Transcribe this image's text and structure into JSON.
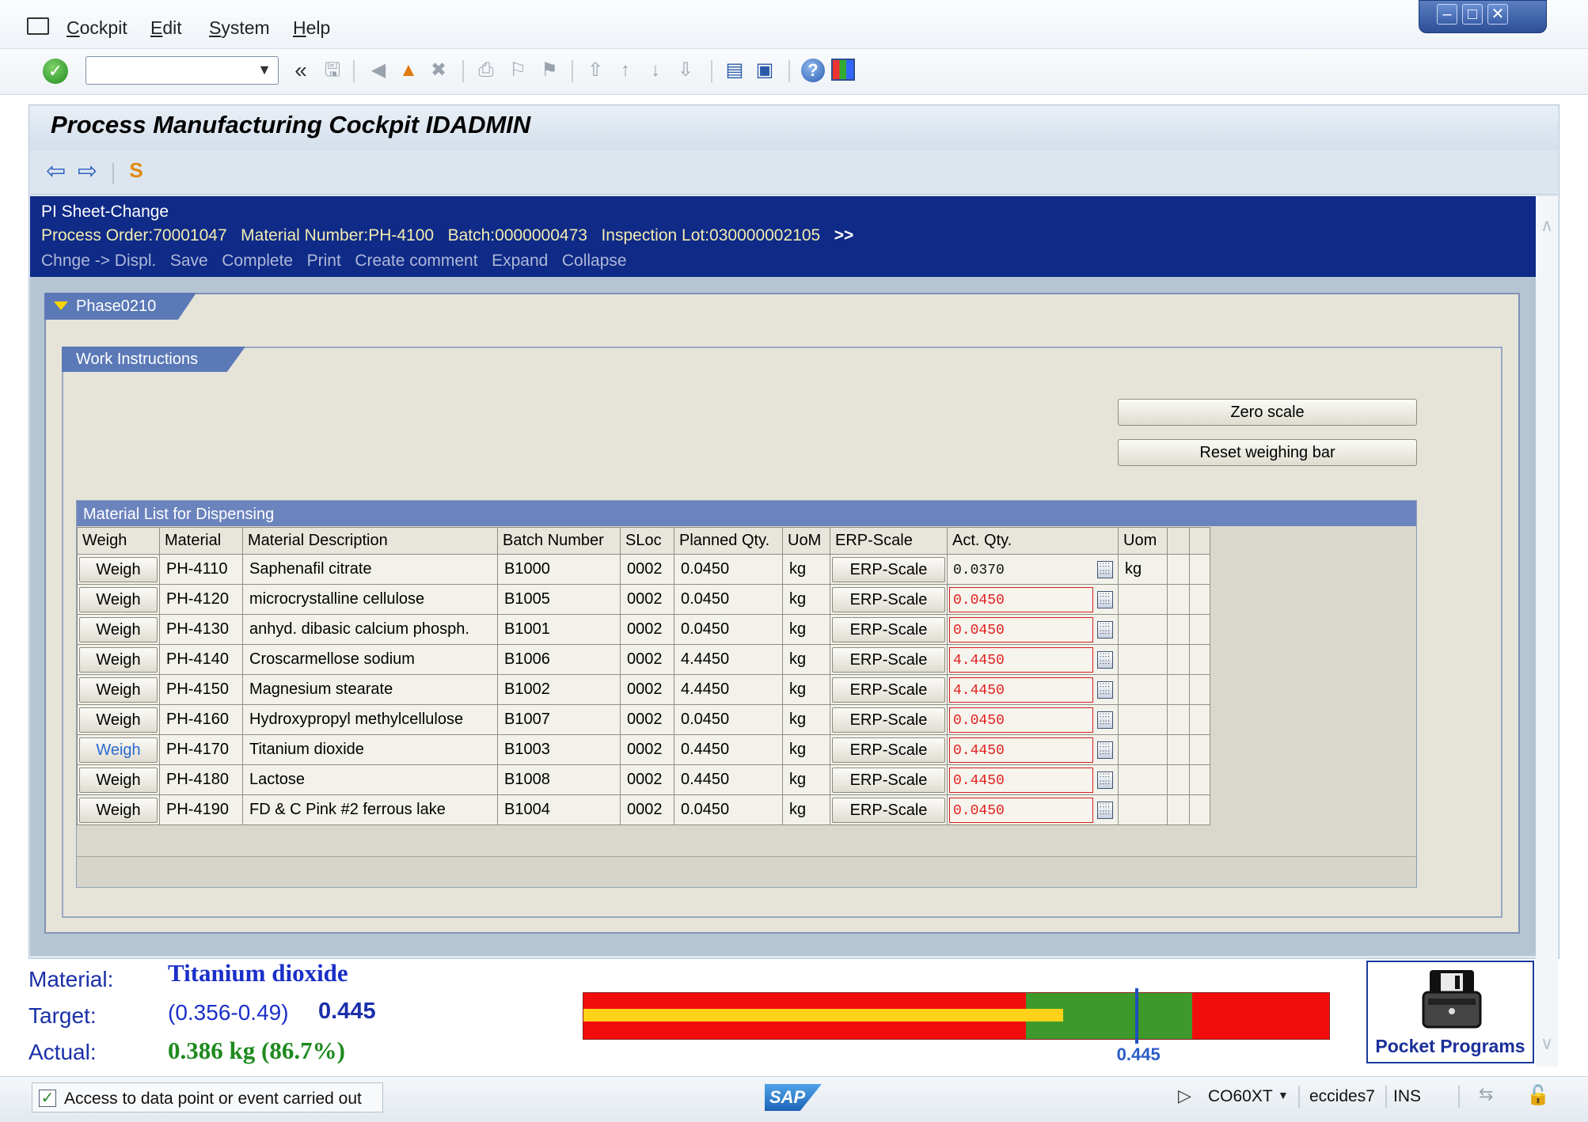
{
  "menu": {
    "items": [
      {
        "u": "C",
        "rest": "ockpit"
      },
      {
        "u": "E",
        "rest": "dit"
      },
      {
        "u": "S",
        "rest": "ystem"
      },
      {
        "u": "H",
        "rest": "elp"
      }
    ]
  },
  "toolbar": {
    "command_value": "",
    "back_glyph": "«"
  },
  "page": {
    "title": "Process Manufacturing Cockpit IDADMIN"
  },
  "pi_header": {
    "title": "PI Sheet-Change",
    "process_order": "Process Order:70001047",
    "material_number": "Material Number:PH-4100",
    "batch": "Batch:0000000473",
    "inspection_lot": "Inspection Lot:030000002105",
    "more": ">>",
    "actions": [
      "Chnge -> Displ.",
      "Save",
      "Complete",
      "Print",
      "Create comment",
      "Expand",
      "Collapse"
    ]
  },
  "phase": {
    "label": "Phase0210",
    "work_instructions": "Work Instructions",
    "zero_scale": "Zero scale",
    "reset_bar": "Reset weighing bar"
  },
  "material_list": {
    "title": "Material List for Dispensing",
    "columns": [
      "Weigh",
      "Material",
      "Material Description",
      "Batch Number",
      "SLoc",
      "Planned Qty.",
      "UoM",
      "ERP-Scale",
      "Act. Qty.",
      "Uom",
      "",
      ""
    ],
    "rows": [
      {
        "weigh": "Weigh",
        "material": "PH-4110",
        "desc": "Saphenafil citrate",
        "batch": "B1000",
        "sloc": "0002",
        "planned": "0.0450",
        "uom": "kg",
        "scale": "ERP-Scale",
        "act": "0.0370",
        "uom2": "kg"
      },
      {
        "weigh": "Weigh",
        "material": "PH-4120",
        "desc": "microcrystalline cellulose",
        "batch": "B1005",
        "sloc": "0002",
        "planned": "0.0450",
        "uom": "kg",
        "scale": "ERP-Scale",
        "act": "0.0450",
        "uom2": ""
      },
      {
        "weigh": "Weigh",
        "material": "PH-4130",
        "desc": "anhyd. dibasic calcium phosph.",
        "batch": "B1001",
        "sloc": "0002",
        "planned": "0.0450",
        "uom": "kg",
        "scale": "ERP-Scale",
        "act": "0.0450",
        "uom2": ""
      },
      {
        "weigh": "Weigh",
        "material": "PH-4140",
        "desc": "Croscarmellose sodium",
        "batch": "B1006",
        "sloc": "0002",
        "planned": "4.4450",
        "uom": "kg",
        "scale": "ERP-Scale",
        "act": "4.4450",
        "uom2": ""
      },
      {
        "weigh": "Weigh",
        "material": "PH-4150",
        "desc": "Magnesium stearate",
        "batch": "B1002",
        "sloc": "0002",
        "planned": "4.4450",
        "uom": "kg",
        "scale": "ERP-Scale",
        "act": "4.4450",
        "uom2": ""
      },
      {
        "weigh": "Weigh",
        "material": "PH-4160",
        "desc": "Hydroxypropyl methylcellulose",
        "batch": "B1007",
        "sloc": "0002",
        "planned": "0.0450",
        "uom": "kg",
        "scale": "ERP-Scale",
        "act": "0.0450",
        "uom2": ""
      },
      {
        "weigh": "Weigh",
        "material": "PH-4170",
        "desc": "Titanium dioxide",
        "batch": "B1003",
        "sloc": "0002",
        "planned": "0.4450",
        "uom": "kg",
        "scale": "ERP-Scale",
        "act": "0.4450",
        "uom2": ""
      },
      {
        "weigh": "Weigh",
        "material": "PH-4180",
        "desc": "Lactose",
        "batch": "B1008",
        "sloc": "0002",
        "planned": "0.4450",
        "uom": "kg",
        "scale": "ERP-Scale",
        "act": "0.4450",
        "uom2": ""
      },
      {
        "weigh": "Weigh",
        "material": "PH-4190",
        "desc": "FD & C Pink #2 ferrous lake",
        "batch": "B1004",
        "sloc": "0002",
        "planned": "0.0450",
        "uom": "kg",
        "scale": "ERP-Scale",
        "act": "0.0450",
        "uom2": ""
      }
    ]
  },
  "weighing": {
    "material_label": "Material:",
    "material_value": "Titanium dioxide",
    "target_label": "Target:",
    "target_range": "(0.356-0.49)",
    "target_value": "0.445",
    "actual_label": "Actual:",
    "actual_value": "0.386 kg (86.7%)",
    "bar_marker_label": "0.445",
    "pocket_programs": "Pocket Programs",
    "bar_scale": {
      "min": 0.0,
      "max": 0.6,
      "green_from": 0.356,
      "green_to": 0.49,
      "target": 0.445,
      "actual": 0.386
    }
  },
  "status": {
    "message": "Access to data point or event carried out",
    "sap_logo": "SAP",
    "transaction": "CO60XT",
    "server": "eccides7",
    "mode": "INS"
  },
  "colors": {
    "header_blue": "#0f2a87",
    "bar_red": "#f20d0d",
    "bar_green": "#3d9a2a",
    "bar_yellow": "#ffd21a",
    "actual_green": "#1e8a1e",
    "label_blue": "#1a2fa8"
  }
}
